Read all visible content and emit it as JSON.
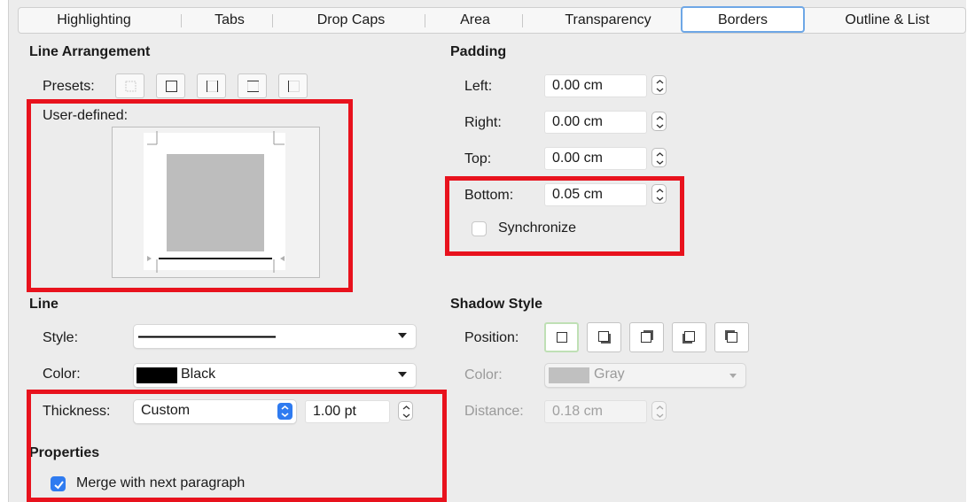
{
  "tabs": [
    {
      "label": "Highlighting"
    },
    {
      "label": "Tabs"
    },
    {
      "label": "Drop Caps"
    },
    {
      "label": "Area"
    },
    {
      "label": "Transparency"
    },
    {
      "label": "Borders",
      "active": true
    },
    {
      "label": "Outline & List"
    }
  ],
  "line_arrangement": {
    "title": "Line Arrangement",
    "presets_label": "Presets:",
    "user_defined_label": "User-defined:"
  },
  "line": {
    "title": "Line",
    "style_label": "Style:",
    "color_label": "Color:",
    "color_value": "Black",
    "color_swatch": "#000000",
    "thickness_label": "Thickness:",
    "thickness_value": "Custom",
    "thickness_amount": "1.00 pt"
  },
  "properties": {
    "title": "Properties",
    "merge_label": "Merge with next paragraph",
    "merge_checked": true
  },
  "padding": {
    "title": "Padding",
    "left_label": "Left:",
    "left_value": "0.00 cm",
    "right_label": "Right:",
    "right_value": "0.00 cm",
    "top_label": "Top:",
    "top_value": "0.00 cm",
    "bottom_label": "Bottom:",
    "bottom_value": "0.05 cm",
    "synchronize_label": "Synchronize",
    "synchronize_checked": false
  },
  "shadow_style": {
    "title": "Shadow Style",
    "position_label": "Position:",
    "color_label": "Color:",
    "color_value": "Gray",
    "color_swatch": "#c0c0c0",
    "distance_label": "Distance:",
    "distance_value": "0.18 cm"
  },
  "colors": {
    "accent": "#2f7bf0",
    "active_tab_border": "#6ea7e6",
    "callout": "#e8121d"
  }
}
